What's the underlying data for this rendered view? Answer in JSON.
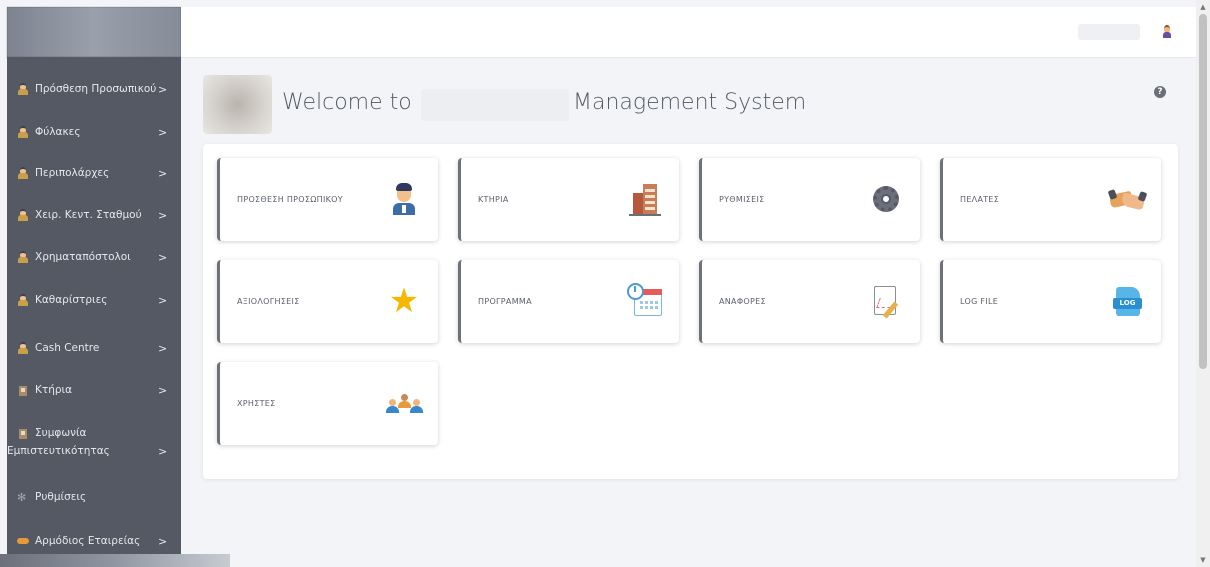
{
  "sidebar": {
    "items": [
      {
        "label": "Πρόσθεση Προσωπικού",
        "icon": "guard-icon"
      },
      {
        "label": "Φύλακες",
        "icon": "guard-icon"
      },
      {
        "label": "Περιπολάρχες",
        "icon": "guard-icon"
      },
      {
        "label": "Χειρ. Κεντ. Σταθμού",
        "icon": "guard-icon"
      },
      {
        "label": "Χρηματαπόστολοι",
        "icon": "guard-icon"
      },
      {
        "label": "Καθαρίστριες",
        "icon": "guard-icon"
      },
      {
        "label": "Cash Centre",
        "icon": "guard-icon"
      },
      {
        "label": "Κτήρια",
        "icon": "building-icon"
      },
      {
        "label": "Συμφωνία",
        "label2": "Εμπιστευτικότητας",
        "icon": "building-icon"
      },
      {
        "label": "Ρυθμίσεις",
        "icon": "gear-icon"
      },
      {
        "label": "Αρμόδιος Εταιρείας",
        "icon": "handshake-icon"
      }
    ],
    "chevron": ">"
  },
  "header": {
    "welcome_prefix": "Welcome to",
    "welcome_suffix": "Management System",
    "help_glyph": "?"
  },
  "cards": [
    {
      "label": "ΠΡΟΣΘΕΣΗ ΠΡΟΣΩΠΙΚΟΥ",
      "icon": "police-officer-icon"
    },
    {
      "label": "ΚΤΗΡΙΑ",
      "icon": "building-icon"
    },
    {
      "label": "ΡΥΘΜΙΣΕΙΣ",
      "icon": "gear-icon"
    },
    {
      "label": "ΠΕΛΑΤΕΣ",
      "icon": "handshake-icon"
    },
    {
      "label": "ΑΞΙΟΛΟΓΗΣΕΙΣ",
      "icon": "star-icon"
    },
    {
      "label": "ΠΡΟΓΡΑΜΜΑ",
      "icon": "calendar-clock-icon"
    },
    {
      "label": "ΑΝΑΦΟΡΕΣ",
      "icon": "report-chart-icon"
    },
    {
      "label": "LOG FILE",
      "icon": "log-file-icon",
      "badge": "LOG"
    },
    {
      "label": "ΧΡΗΣΤΕΣ",
      "icon": "users-group-icon"
    }
  ],
  "colors": {
    "sidebar_bg": "#545963",
    "page_bg": "#f3f4f7",
    "card_border": "#6d727a",
    "star": "#f5b700"
  }
}
